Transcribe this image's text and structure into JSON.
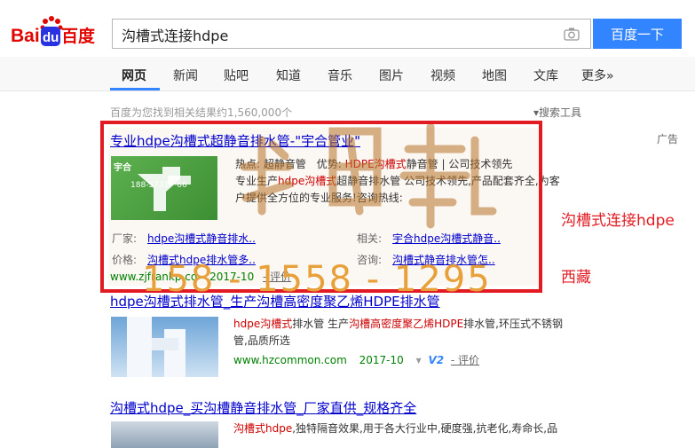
{
  "logo": {
    "text_left": "Bai",
    "text_mid": "du",
    "text_right": "百度",
    "colors": {
      "blue": "#2932e1",
      "red": "#e10602"
    }
  },
  "search": {
    "query": "沟槽式连接hdpe",
    "button": "百度一下",
    "camera_icon": "camera-icon"
  },
  "nav": {
    "tabs": [
      "网页",
      "新闻",
      "贴吧",
      "知道",
      "音乐",
      "图片",
      "视频",
      "地图",
      "文库",
      "更多»"
    ],
    "active": "网页"
  },
  "stats": {
    "result_count": "百度为您找到相关结果约1,560,000个",
    "tools": "搜索工具"
  },
  "ad": {
    "tag": "广告",
    "title": "专业hdpe沟槽式超静音排水管-\"宇合管业\"",
    "image_text": "宇合",
    "image_phone": "188-5731-··66",
    "desc_line1_a": "热点: 超静音管",
    "desc_line1_b": "优势:",
    "desc_line1_c": "HDPE沟槽式",
    "desc_line1_d": "静音管 | 公司技术领先",
    "desc_line2_a": "专业生产",
    "desc_line2_b": "hdpe沟槽式",
    "desc_line2_c": "超静音排水管 公司技术领先,产品配套齐全,为客",
    "desc_line3": "户提供全方位的专业服务!咨询热线:",
    "rows": [
      {
        "label": "厂家:",
        "value": "hdpe沟槽式静音排水.."
      },
      {
        "label": "相关:",
        "value": "宇合hdpe沟槽式静音.."
      },
      {
        "label": "价格:",
        "value": "沟槽式hdpe排水管多.."
      },
      {
        "label": "咨询:",
        "value": "沟槽式静音排水管怎.."
      }
    ],
    "url": "www.zjfrankp.co",
    "date": "2017-10",
    "review": "- 评价"
  },
  "overlay": {
    "phone": "158 - 1558 - 1295",
    "keyword": "沟槽式连接hdpe",
    "location": "西藏"
  },
  "results": [
    {
      "title": "hdpe沟槽式排水管_生产沟槽高密度聚乙烯HDPE排水管",
      "desc_a": "hdpe沟槽式",
      "desc_b": "排水管 生产",
      "desc_c": "沟槽高密度聚乙烯HDPE",
      "desc_d": "排水管,环压式不锈钢",
      "desc_line2": "管,品质所选",
      "url": "www.hzcommon.com",
      "date": "2017-10",
      "badge": "V2",
      "review": "- 评价"
    },
    {
      "title": "沟槽式hdpe_买沟槽静音排水管_厂家直供_规格齐全",
      "desc_a": "沟槽式hdpe",
      "desc_b": ",独特隔音效果,用于各大行业中,硬度强,抗老化,寿命长,品"
    }
  ]
}
